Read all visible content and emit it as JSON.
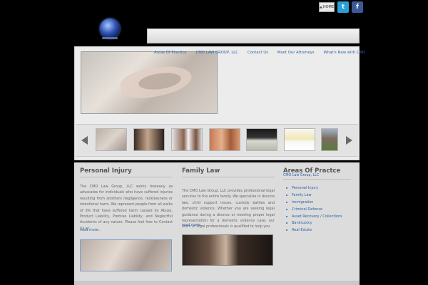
{
  "header": {
    "home_label": "HOME",
    "social": [
      {
        "name": "twitter",
        "glyph": "t"
      },
      {
        "name": "facebook",
        "glyph": "f"
      }
    ]
  },
  "nav": {
    "items": [
      "Areas Of Practice",
      "CMO LAW GROUP, LLC",
      "Contact Us",
      "Meet Our Attorneys",
      "What's New with CMO"
    ]
  },
  "columns": {
    "personal_injury": {
      "title": "Personal Injury",
      "text": "The CMO Law Group, LLC works tirelessly as advocates for individuals who have suffered injuries resulting from anothers negligence, recklessness or intentional harm. We represent people from all walks of life that have suffered harm caused by Abuse, Product Liability, Premise Liability, and Neglectful Accidents of any nature. Please feel free to Contact Us at",
      "more": "read more.."
    },
    "family_law": {
      "title": "Family Law",
      "text": "The CMO Law Group, LLC provides professional legal services to the entire family. We specialize in divorce law, child support issues, custody battles and domestic violence. Whether you are seeking legal guidance during a divorce or needing proper legal representation for a domestic violence case, our team of legal professionals is qualified to help you",
      "more": "read more.."
    },
    "areas": {
      "title": "Areas Of Practce",
      "subtitle": "CMO Law Group, LLC",
      "items": [
        "Personal Injury",
        "Family Law",
        "Immigration",
        "Criminal Defense",
        "Asset Recovery / Collections",
        "Bankruptcy",
        "Real Estate"
      ]
    }
  },
  "colors": {
    "link": "#2a63a8",
    "heading": "#555555",
    "background": "#000000"
  }
}
